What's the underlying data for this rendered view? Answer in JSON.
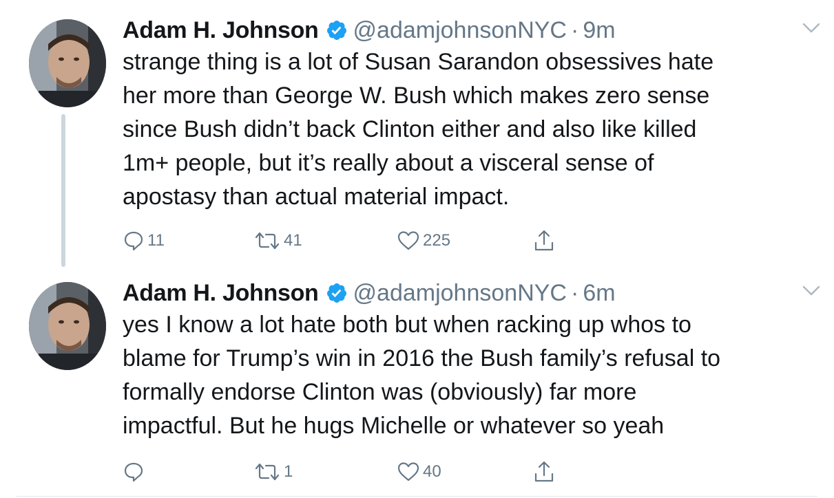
{
  "colors": {
    "text": "#14171a",
    "secondary": "#657786",
    "verified_blue": "#1da1f2",
    "thread_line": "#ccd6dd",
    "divider": "#e1e8ed"
  },
  "tweets": [
    {
      "author_name": "Adam H. Johnson",
      "verified": true,
      "handle": "@adamjohnsonNYC",
      "separator": "·",
      "time": "9m",
      "lines": [
        "strange thing is a lot of Susan Sarandon obsessives hate",
        "her more than George W. Bush which makes zero sense",
        "since Bush didn’t back Clinton either and also like killed",
        "1m+ people, but it’s really about a visceral sense of",
        "apostasy than actual material impact."
      ],
      "reply_count": "11",
      "retweet_count": "41",
      "like_count": "225",
      "icons": [
        "reply-icon",
        "retweet-icon",
        "like-icon",
        "share-icon",
        "caret-down-icon",
        "verified-icon"
      ]
    },
    {
      "author_name": "Adam H. Johnson",
      "verified": true,
      "handle": "@adamjohnsonNYC",
      "separator": "·",
      "time": "6m",
      "lines": [
        "yes I know a lot hate both but when racking up whos to",
        "blame for Trump’s win in 2016 the Bush family’s refusal to",
        "formally endorse Clinton was (obviously) far more",
        "impactful. But he hugs Michelle or whatever so yeah"
      ],
      "reply_count": "",
      "retweet_count": "1",
      "like_count": "40",
      "icons": [
        "reply-icon",
        "retweet-icon",
        "like-icon",
        "share-icon",
        "caret-down-icon",
        "verified-icon"
      ]
    }
  ]
}
